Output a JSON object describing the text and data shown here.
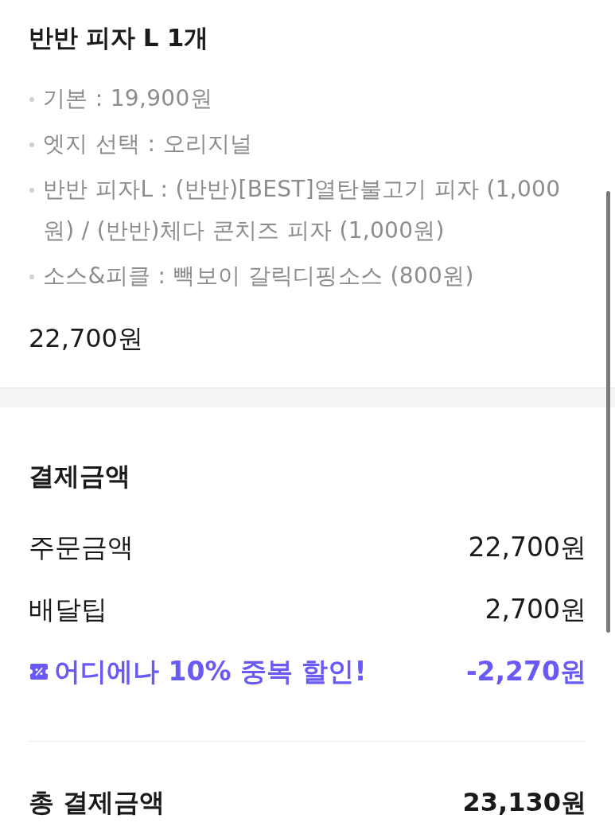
{
  "order_item": {
    "title": "반반 피자 L 1개",
    "options": [
      "기본 : 19,900원",
      "엣지 선택 : 오리지널",
      "반반 피자L : (반반)[BEST]열탄불고기 피자 (1,000원) / (반반)체다 콘치즈 피자 (1,000원)",
      "소스&피클 : 빽보이 갈릭디핑소스 (800원)"
    ],
    "price": "22,700원"
  },
  "payment": {
    "heading": "결제금액",
    "rows": [
      {
        "kind": "normal",
        "label": "주문금액",
        "value": "22,700원"
      },
      {
        "kind": "normal",
        "label": "배달팁",
        "value": "2,700원"
      },
      {
        "kind": "discount",
        "label": "어디에나 10% 중복 할인!",
        "value": "-2,270원"
      }
    ],
    "total": {
      "label": "총 결제금액",
      "value": "23,130원"
    }
  }
}
